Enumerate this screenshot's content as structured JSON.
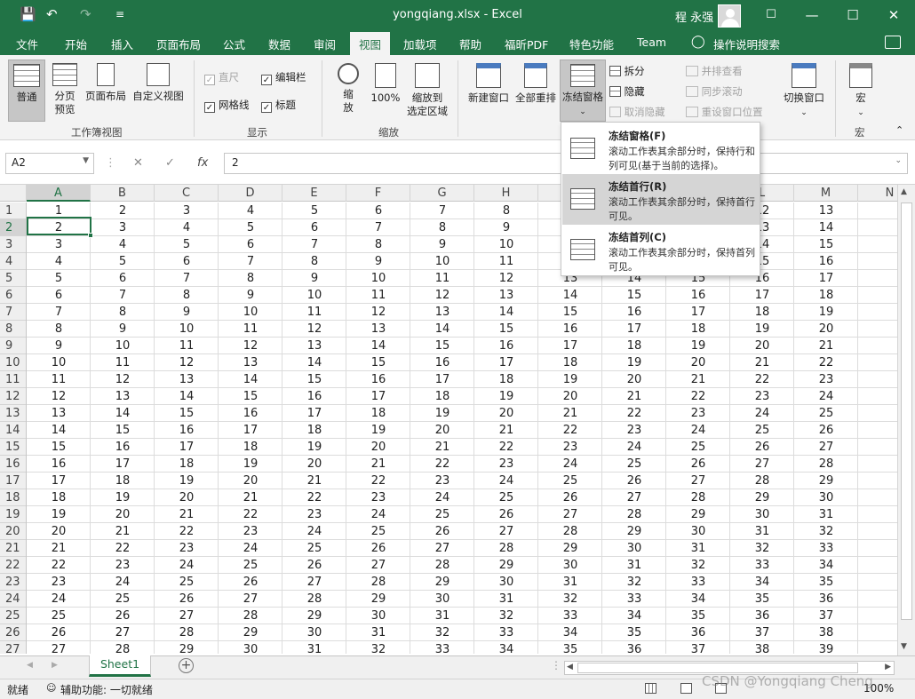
{
  "window": {
    "title": "yongqiang.xlsx  -  Excel",
    "user": "程 永强",
    "quick_access": {
      "save": "💾",
      "undo": "↶",
      "redo": "↷",
      "more": "≡"
    },
    "controls": {
      "ribbon_display": "☐",
      "minimize": "—",
      "maximize": "☐",
      "close": "✕"
    }
  },
  "tabs": [
    {
      "label": "文件"
    },
    {
      "label": "开始"
    },
    {
      "label": "插入"
    },
    {
      "label": "页面布局"
    },
    {
      "label": "公式"
    },
    {
      "label": "数据"
    },
    {
      "label": "审阅"
    },
    {
      "label": "视图",
      "active": true
    },
    {
      "label": "加载项"
    },
    {
      "label": "帮助"
    },
    {
      "label": "福昕PDF"
    },
    {
      "label": "特色功能"
    },
    {
      "label": "Team"
    },
    {
      "label": "操作说明搜索"
    }
  ],
  "ribbon": {
    "workbook_views": {
      "group_label": "工作簿视图",
      "normal": "普通",
      "page_break_1": "分页",
      "page_break_2": "预览",
      "page_layout": "页面布局",
      "custom_views": "自定义视图"
    },
    "show": {
      "group_label": "显示",
      "ruler": "直尺",
      "formula_bar": "编辑栏",
      "gridlines": "网格线",
      "headings": "标题"
    },
    "zoom": {
      "group_label": "缩放",
      "zoom_1": "缩",
      "zoom_2": "放",
      "hundred": "100%",
      "zoom_to_selection_1": "缩放到",
      "zoom_to_selection_2": "选定区域"
    },
    "window": {
      "new_window": "新建窗口",
      "arrange_all": "全部重排",
      "freeze_panes": "冻结窗格",
      "split": "拆分",
      "hide": "隐藏",
      "unhide": "取消隐藏",
      "view_side_by_side": "并排查看",
      "sync_scroll": "同步滚动",
      "reset_position": "重设窗口位置",
      "switch_windows": "切换窗口"
    },
    "macros": {
      "label": "宏",
      "group_label": "宏"
    }
  },
  "formula_bar": {
    "name_box": "A2",
    "fx": "fx",
    "value": "2"
  },
  "columns": [
    "A",
    "B",
    "C",
    "D",
    "E",
    "F",
    "G",
    "H",
    "I",
    "J",
    "K",
    "L",
    "M",
    "N"
  ],
  "active_column": "A",
  "active_row": 2,
  "freeze_menu": {
    "items": [
      {
        "title": "冻结窗格(F)",
        "desc": "滚动工作表其余部分时，保持行和列可见(基于当前的选择)。"
      },
      {
        "title": "冻结首行(R)",
        "desc": "滚动工作表其余部分时，保持首行可见。",
        "highlighted": true
      },
      {
        "title": "冻结首列(C)",
        "desc": "滚动工作表其余部分时，保持首列可见。"
      }
    ]
  },
  "sheets": [
    {
      "name": "Sheet1",
      "active": true
    }
  ],
  "status": {
    "ready": "就绪",
    "accessibility": "辅助功能: 一切就绪",
    "zoom": "100%"
  },
  "watermark": "CSDN @Yongqiang Cheng"
}
